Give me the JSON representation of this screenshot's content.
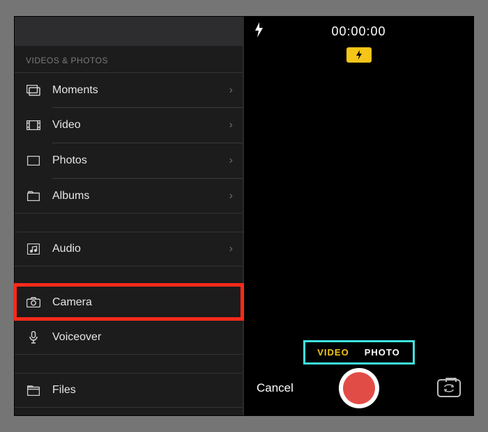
{
  "left": {
    "section_label": "VIDEOS & PHOTOS",
    "items": {
      "moments": "Moments",
      "video": "Video",
      "photos": "Photos",
      "albums": "Albums",
      "audio": "Audio",
      "camera": "Camera",
      "voiceover": "Voiceover",
      "files": "Files"
    }
  },
  "right": {
    "timer": "00:00:00",
    "mode_video": "VIDEO",
    "mode_photo": "PHOTO",
    "cancel": "Cancel"
  }
}
